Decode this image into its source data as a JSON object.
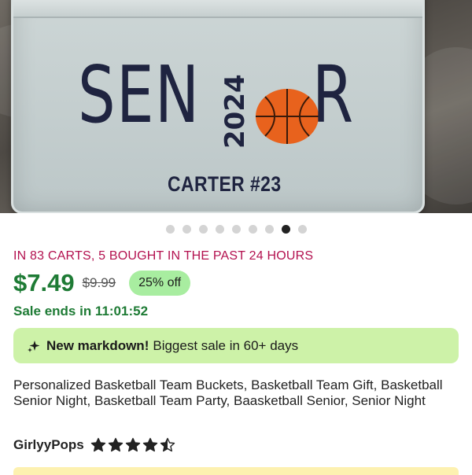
{
  "hero": {
    "bin_word_left": "SEN",
    "bin_word_right": "R",
    "bin_year": "2024",
    "bin_name": "CARTER #23",
    "icon": "basketball-icon"
  },
  "carousel": {
    "total": 9,
    "active_index": 7
  },
  "listing": {
    "cart_notice": "IN 83 CARTS, 5 BOUGHT IN THE PAST 24 HOURS",
    "price": "$7.49",
    "original_price": "$9.99",
    "discount_badge": "25% off",
    "sale_ends": "Sale ends in 11:01:52",
    "markdown_bold": "New markdown!",
    "markdown_text": "Biggest sale in 60+ days",
    "markdown_icon": "sparkle-icon",
    "title": "Personalized Basketball Team Buckets, Basketball Team Gift, Basketball Senior Night, Basketball Team Party, Baasketball Senior, Senior Night",
    "seller_name": "GirlyyPops",
    "rating": 4.5
  },
  "colors": {
    "cart_notice": "#b3114f",
    "price": "#1e7b35",
    "discount_bg": "#a8eda0",
    "markdown_bg": "#cdf2a8",
    "basketball": "#e8621d"
  }
}
